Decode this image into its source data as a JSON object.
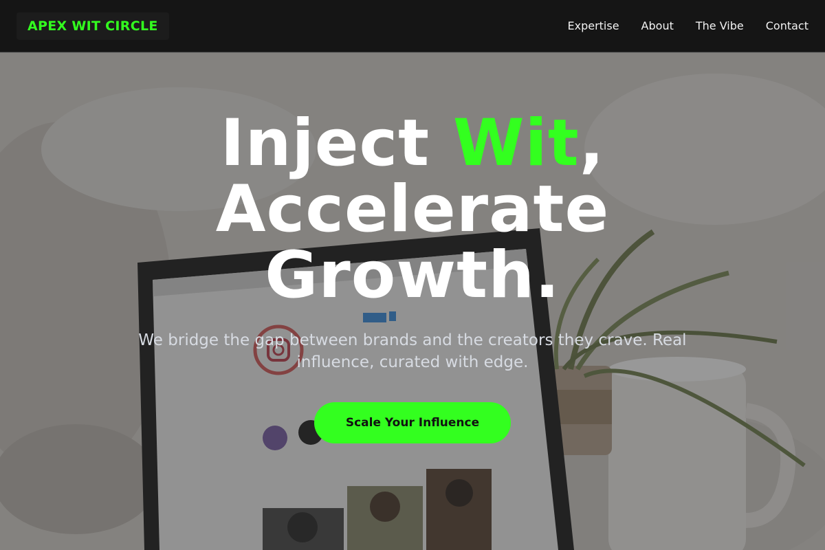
{
  "brand": {
    "name": "APEX WIT CIRCLE"
  },
  "nav": {
    "items": [
      {
        "label": "Expertise"
      },
      {
        "label": "About"
      },
      {
        "label": "The Vibe"
      },
      {
        "label": "Contact"
      }
    ]
  },
  "hero": {
    "headline_part1": "Inject ",
    "headline_accent": "Wit",
    "headline_part2": ", Accelerate Growth.",
    "subtitle": "We bridge the gap between brands and the creators they crave. Real influence, curated with edge.",
    "cta_label": "Scale Your Influence",
    "background_image": "laptop-instagram-photo"
  },
  "colors": {
    "accent": "#33ff1f",
    "header_bg": "#151515",
    "text": "#ffffff",
    "subtitle": "#d7dbe2"
  }
}
